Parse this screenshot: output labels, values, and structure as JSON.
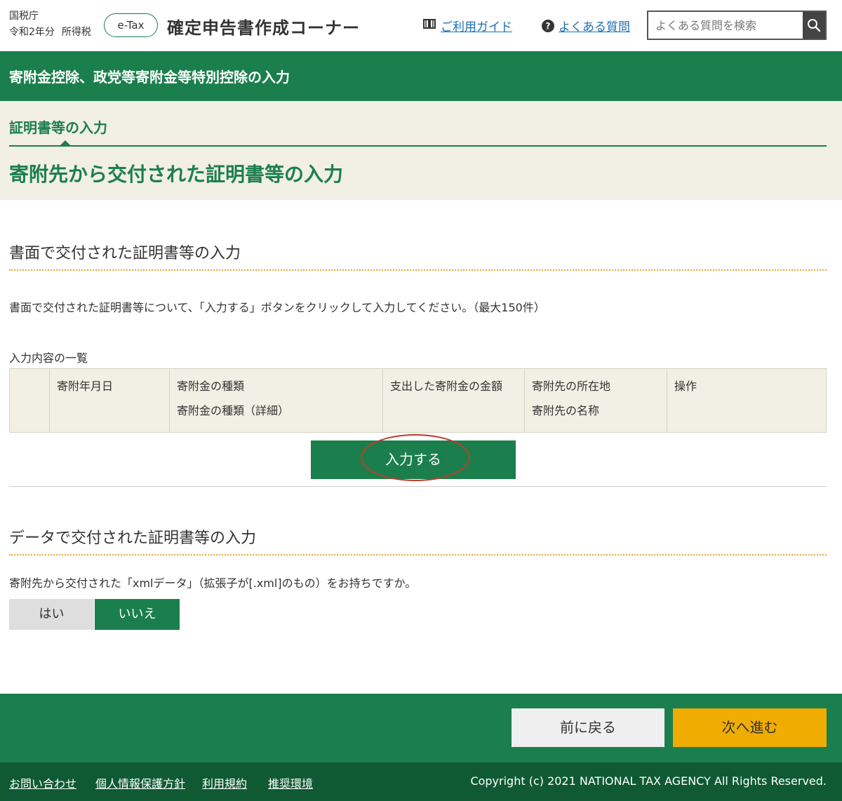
{
  "header": {
    "agency": "国税庁",
    "year": "令和2年分",
    "tax_type": "所得税",
    "badge": "e-Tax",
    "site_title": "確定申告書作成コーナー",
    "guide_link": "ご利用ガイド",
    "faq_link": "よくある質問",
    "search_placeholder": "よくある質問を検索"
  },
  "page": {
    "heading": "寄附金控除、政党等寄附金等特別控除の入力",
    "step_label": "証明書等の入力",
    "step_title": "寄附先から交付された証明書等の入力"
  },
  "paper_section": {
    "title": "書面で交付された証明書等の入力",
    "description": "書面で交付された証明書等について、「入力する」ボタンをクリックして入力してください。（最大150件）",
    "list_label": "入力内容の一覧",
    "columns": [
      {
        "line1": "",
        "line2": ""
      },
      {
        "line1": "寄附年月日",
        "line2": ""
      },
      {
        "line1": "寄附金の種類",
        "line2": "寄附金の種類（詳細）"
      },
      {
        "line1": "支出した寄附金の金額",
        "line2": ""
      },
      {
        "line1": "寄附先の所在地",
        "line2": "寄附先の名称"
      },
      {
        "line1": "操作",
        "line2": ""
      }
    ],
    "input_button": "入力する"
  },
  "data_section": {
    "title": "データで交付された証明書等の入力",
    "question": "寄附先から交付された「xmlデータ」（拡張子が[.xml]のもの）をお持ちですか。",
    "yes": "はい",
    "no": "いいえ",
    "selected": "いいえ"
  },
  "navigation": {
    "back": "前に戻る",
    "next": "次へ進む"
  },
  "footer": {
    "links": [
      "お問い合わせ",
      "個人情報保護方針",
      "利用規約",
      "推奨環境"
    ],
    "copyright": "Copyright (c) 2021 NATIONAL TAX AGENCY All Rights Reserved."
  },
  "colors": {
    "primary_green": "#1b7f4d",
    "dark_green": "#0f5a33",
    "beige": "#f2efe4",
    "next_button": "#f0ac00",
    "link_blue": "#1a6fb5",
    "highlight_ring": "#c23a2a"
  }
}
